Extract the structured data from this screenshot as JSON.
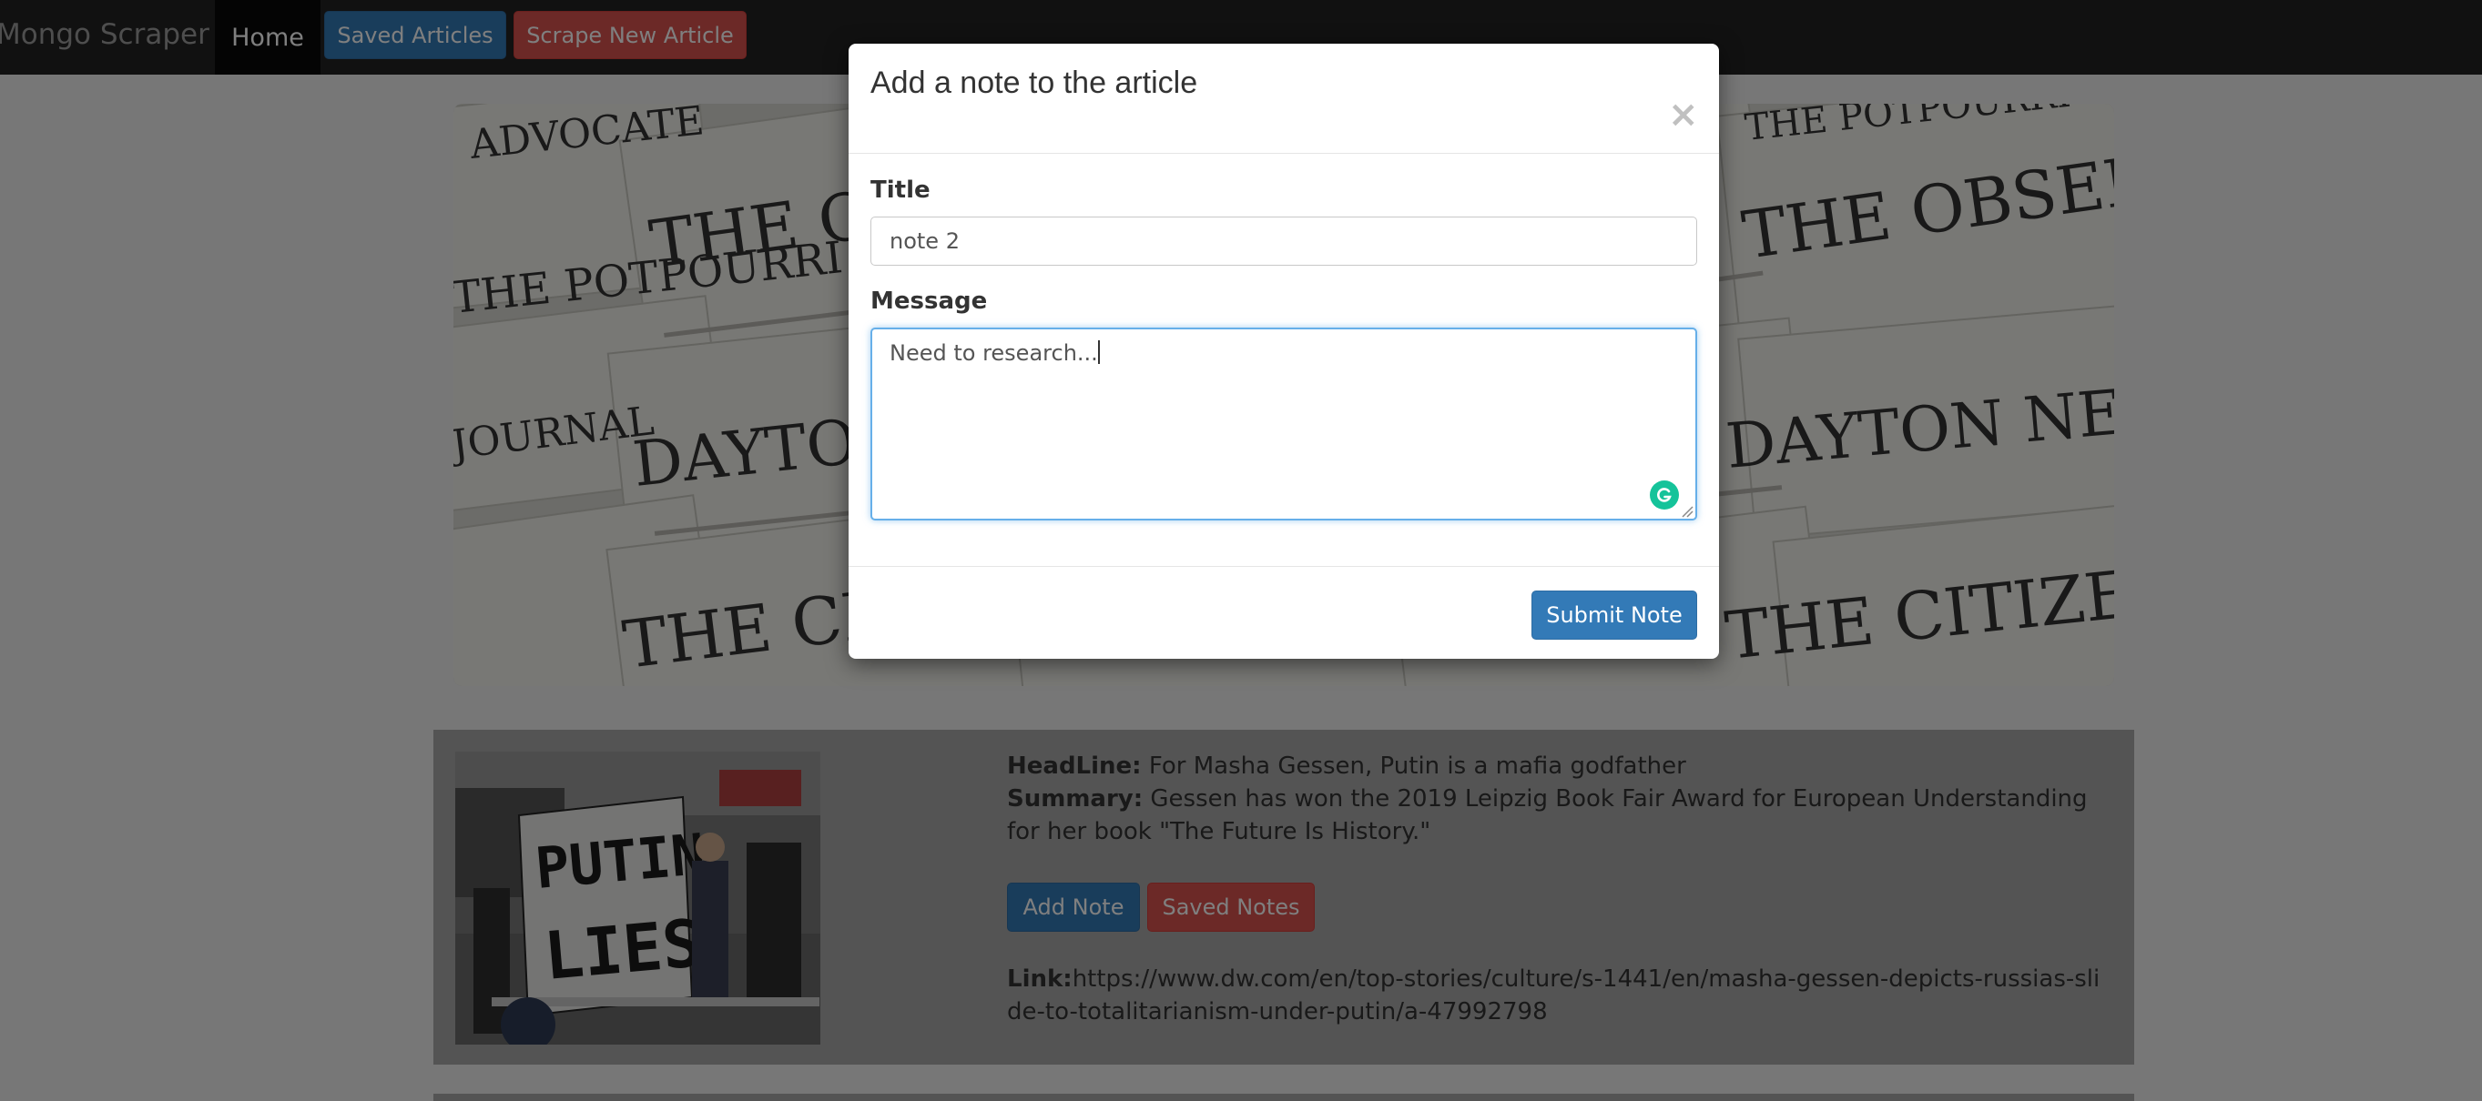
{
  "navbar": {
    "brand": "Mongo Scraper",
    "home_label": "Home",
    "saved_articles_label": "Saved Articles",
    "scrape_label": "Scrape New Article"
  },
  "hero": {
    "newspaper_mastheads": [
      "THE OBSERVER",
      "DAYTON NEWS",
      "THE CITIZEN",
      "THE POTPOURRI",
      "ADVOCATE",
      "JOURNAL"
    ]
  },
  "article": {
    "headline_label": "HeadLine:",
    "headline": "For Masha Gessen, Putin is a mafia godfather",
    "summary_label": "Summary:",
    "summary": "Gessen has won the 2019 Leipzig Book Fair Award for European Understanding for her book \"The Future Is History.\"",
    "add_note_label": "Add Note",
    "saved_notes_label": "Saved Notes",
    "link_label": "Link:",
    "link": "https://www.dw.com/en/top-stories/culture/s-1441/en/masha-gessen-depicts-russias-slide-to-totalitarianism-under-putin/a-47992798",
    "photo_sign_text": [
      "PUTIN",
      "LIES"
    ]
  },
  "modal": {
    "title": "Add a note to the article",
    "close_symbol": "×",
    "title_label": "Title",
    "title_value": "note 2",
    "message_label": "Message",
    "message_value": "Need to research...",
    "submit_label": "Submit Note"
  },
  "colors": {
    "primary": "#337ab7",
    "danger": "#d9534f",
    "navbar_bg": "#222222",
    "focus_border": "#66afe9",
    "grammarly": "#15c39a"
  }
}
